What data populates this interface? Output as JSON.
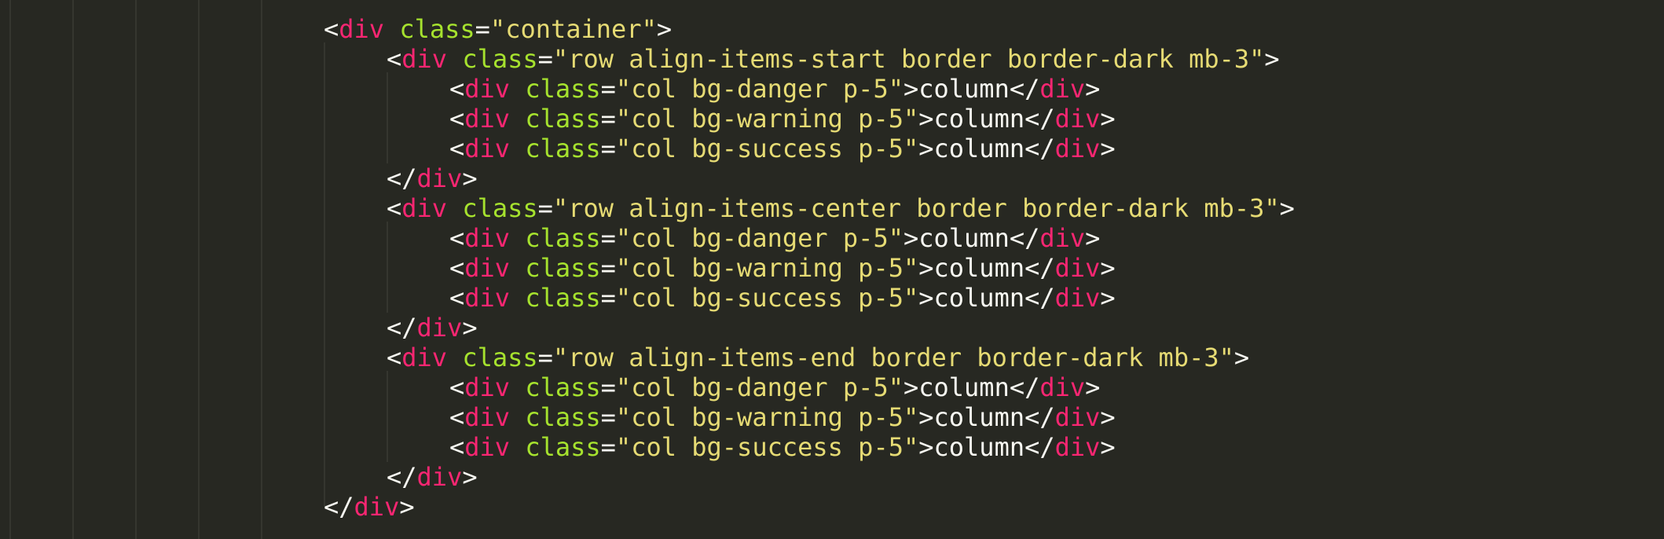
{
  "editor": {
    "theme": {
      "background": "#272822",
      "punctuation": "#f8f8f2",
      "tag": "#f92672",
      "attribute": "#a6e22e",
      "string": "#e6db74",
      "text": "#f8f8f2",
      "indent_guide": "#35362f"
    },
    "lines": [
      {
        "indent": 0,
        "kind": "open",
        "tag": "div",
        "attr": "class",
        "value": "\"container\""
      },
      {
        "indent": 1,
        "kind": "open",
        "tag": "div",
        "attr": "class",
        "value": "\"row align-items-start border border-dark mb-3\""
      },
      {
        "indent": 2,
        "kind": "element",
        "tag": "div",
        "attr": "class",
        "value": "\"col bg-danger p-5\"",
        "text": "column"
      },
      {
        "indent": 2,
        "kind": "element",
        "tag": "div",
        "attr": "class",
        "value": "\"col bg-warning p-5\"",
        "text": "column"
      },
      {
        "indent": 2,
        "kind": "element",
        "tag": "div",
        "attr": "class",
        "value": "\"col bg-success p-5\"",
        "text": "column"
      },
      {
        "indent": 1,
        "kind": "close",
        "tag": "div"
      },
      {
        "indent": 1,
        "kind": "open",
        "tag": "div",
        "attr": "class",
        "value": "\"row align-items-center border border-dark mb-3\""
      },
      {
        "indent": 2,
        "kind": "element",
        "tag": "div",
        "attr": "class",
        "value": "\"col bg-danger p-5\"",
        "text": "column"
      },
      {
        "indent": 2,
        "kind": "element",
        "tag": "div",
        "attr": "class",
        "value": "\"col bg-warning p-5\"",
        "text": "column"
      },
      {
        "indent": 2,
        "kind": "element",
        "tag": "div",
        "attr": "class",
        "value": "\"col bg-success p-5\"",
        "text": "column"
      },
      {
        "indent": 1,
        "kind": "close",
        "tag": "div"
      },
      {
        "indent": 1,
        "kind": "open",
        "tag": "div",
        "attr": "class",
        "value": "\"row align-items-end border border-dark mb-3\""
      },
      {
        "indent": 2,
        "kind": "element",
        "tag": "div",
        "attr": "class",
        "value": "\"col bg-danger p-5\"",
        "text": "column"
      },
      {
        "indent": 2,
        "kind": "element",
        "tag": "div",
        "attr": "class",
        "value": "\"col bg-warning p-5\"",
        "text": "column"
      },
      {
        "indent": 2,
        "kind": "element",
        "tag": "div",
        "attr": "class",
        "value": "\"col bg-success p-5\"",
        "text": "column"
      },
      {
        "indent": 1,
        "kind": "close",
        "tag": "div"
      },
      {
        "indent": 0,
        "kind": "close",
        "tag": "div"
      }
    ]
  }
}
